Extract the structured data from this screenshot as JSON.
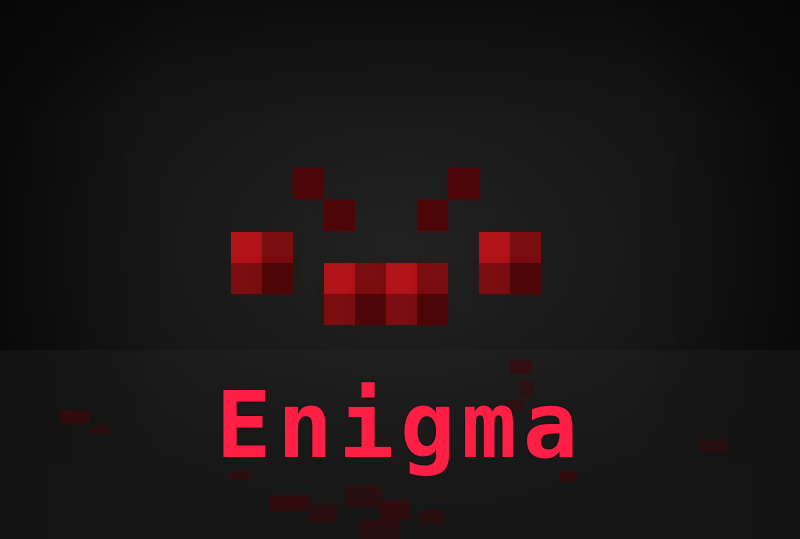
{
  "title": "Enigma",
  "colors": {
    "background": "#151515",
    "title": "#ff1f44",
    "eye_bright": "#b3141a",
    "eye_mid": "#7a0d10",
    "eye_dark": "#4d0608",
    "blood": "#3a0a0c"
  },
  "creature": {
    "name": "spider-face",
    "eyes": 4
  }
}
